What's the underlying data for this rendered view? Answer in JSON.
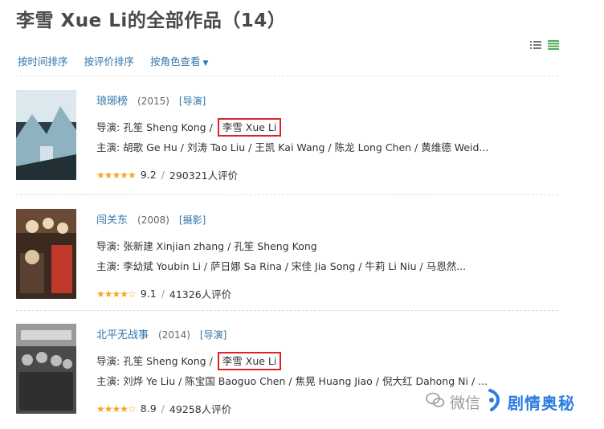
{
  "page": {
    "title": "李雪 Xue Li的全部作品（14）"
  },
  "sort": {
    "by_time": "按时间排序",
    "by_rating": "按评价排序",
    "by_role": "按角色查看"
  },
  "works": [
    {
      "title": "琅琊榜",
      "year": "(2015)",
      "role": "[导演]",
      "directors_prefix": "导演: ",
      "directors_main": "孔笙 Sheng Kong",
      "directors_sep": " / ",
      "directors_highlight": "李雪 Xue Li",
      "cast": "主演: 胡歌 Ge Hu / 刘涛 Tao Liu / 王凯 Kai Wang / 陈龙 Long Chen / 黄维德 Weid...",
      "score": "9.2",
      "ratings": "290321人评价",
      "stars": "★★★★★",
      "poster_colors": [
        "#2c3e45",
        "#8fb2c0",
        "#dce8ee"
      ]
    },
    {
      "title": "闯关东",
      "year": "(2008)",
      "role": "[摄影]",
      "directors_prefix": "导演: ",
      "directors_main": "张新建 Xinjian zhang / 孔笙 Sheng Kong",
      "directors_sep": "",
      "directors_highlight": "",
      "cast": "主演: 李幼斌 Youbin Li / 萨日娜 Sa Rina / 宋佳 Jia Song / 牛莉 Li Niu / 马恩然...",
      "score": "9.1",
      "ratings": "41326人评价",
      "stars": "★★★★☆",
      "poster_colors": [
        "#3a2a20",
        "#c0392b",
        "#e9d8b4"
      ]
    },
    {
      "title": "北平无战事",
      "year": "(2014)",
      "role": "[导演]",
      "directors_prefix": "导演: ",
      "directors_main": "孔笙 Sheng Kong",
      "directors_sep": " / ",
      "directors_highlight": "李雪 Xue Li",
      "cast": "主演: 刘烨 Ye Liu / 陈宝国 Baoguo Chen / 焦晃 Huang Jiao / 倪大红 Dahong Ni / ...",
      "score": "8.9",
      "ratings": "49258人评价",
      "stars": "★★★★☆",
      "poster_colors": [
        "#4a4a4a",
        "#9a9a9a",
        "#d6d6d6"
      ]
    }
  ],
  "watermark": {
    "faded": "微信",
    "brand": "剧情奥秘"
  },
  "colors": {
    "link": "#3377aa",
    "highlight_border": "#d9262c",
    "star": "#f5a623",
    "watermark": "#2b7de0"
  }
}
